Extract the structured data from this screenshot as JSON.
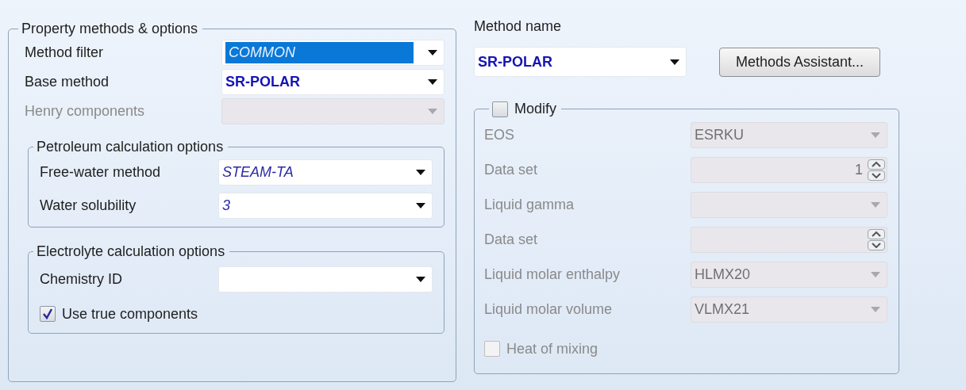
{
  "property_methods": {
    "title": "Property methods & options",
    "fields": [
      {
        "label": "Method filter",
        "value": "COMMON",
        "kind": "dropdown",
        "disabled": false,
        "bold": false,
        "italic": true,
        "highlighted": true
      },
      {
        "label": "Base method",
        "value": "SR-POLAR",
        "kind": "dropdown",
        "disabled": false,
        "bold": true,
        "italic": false
      },
      {
        "label": "Henry components",
        "kind": "dropdown",
        "disabled": true
      }
    ],
    "petroleum": {
      "title": "Petroleum calculation options",
      "fields": [
        {
          "label": "Free-water method",
          "value": "STEAM-TA",
          "kind": "dropdown",
          "disabled": false,
          "bold": false,
          "italic": true
        },
        {
          "label": "Water solubility",
          "value": "3",
          "kind": "dropdown",
          "disabled": false,
          "bold": false,
          "italic": true
        }
      ]
    },
    "electrolyte": {
      "title": "Electrolyte calculation options",
      "fields": [
        {
          "label": "Chemistry ID",
          "kind": "dropdown",
          "disabled": false
        }
      ],
      "use_true_components": {
        "label": "Use true components",
        "checked": true,
        "disabled": false
      }
    }
  },
  "method_name": {
    "label": "Method name",
    "value": "SR-POLAR",
    "bold": true,
    "italic": false,
    "button": "Methods Assistant..."
  },
  "modify": {
    "label": "Modify",
    "checked": false,
    "fields": [
      {
        "label": "EOS",
        "value": "ESRKU",
        "kind": "dropdown",
        "disabled": true
      },
      {
        "label": "Data set",
        "value": "1",
        "kind": "spin",
        "disabled": true
      },
      {
        "label": "Liquid gamma",
        "kind": "dropdown",
        "disabled": true
      },
      {
        "label": "Data set",
        "kind": "spin",
        "disabled": true
      },
      {
        "label": "Liquid molar enthalpy",
        "value": "HLMX20",
        "kind": "dropdown",
        "disabled": true
      },
      {
        "label": "Liquid molar volume",
        "value": "VLMX21",
        "kind": "dropdown",
        "disabled": true
      }
    ],
    "heat_of_mixing": {
      "label": "Heat of mixing",
      "checked": false,
      "disabled": true
    }
  }
}
